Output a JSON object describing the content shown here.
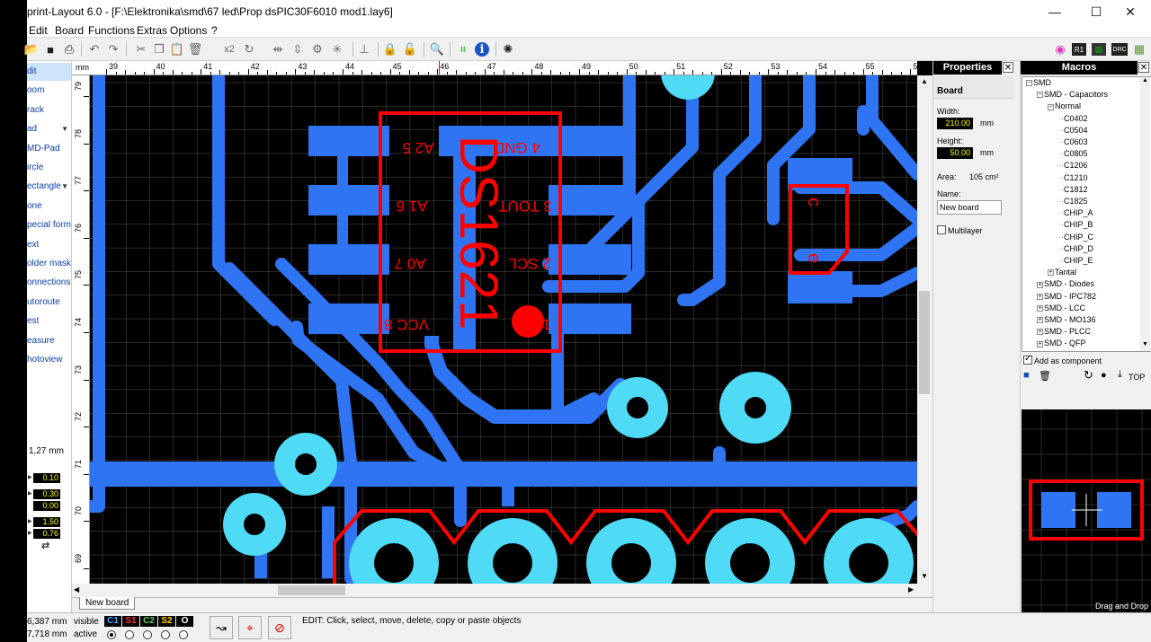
{
  "window": {
    "title": "print-Layout 6.0 - [F:\\Elektronika\\smd\\67 led\\Prop dsPIC30F6010 mod1.lay6]",
    "minimize": "—",
    "maximize": "☐",
    "close": "✕"
  },
  "menu": [
    "Edit",
    "Board",
    "Functions",
    "Extras",
    "Options",
    "?"
  ],
  "toolbar": {
    "zoom_icon": "🔍",
    "x2": "x2",
    "info": "i"
  },
  "tools": [
    {
      "label": "dit",
      "selected": true
    },
    {
      "label": "oom"
    },
    {
      "label": "rack"
    },
    {
      "label": "ad",
      "arrow": true
    },
    {
      "label": "MD-Pad"
    },
    {
      "label": "ircle"
    },
    {
      "label": "ectangle",
      "arrow": true
    },
    {
      "label": "one"
    },
    {
      "label": "pecial form"
    },
    {
      "label": "ext"
    },
    {
      "label": "older mask"
    },
    {
      "label": "onnections"
    },
    {
      "label": "utoroute"
    },
    {
      "label": "est"
    },
    {
      "label": "easure"
    },
    {
      "label": "hotoview"
    }
  ],
  "grid": "1,27 mm",
  "numvals": [
    "0.10",
    "0.30",
    "0.00",
    "1.50",
    "0.76"
  ],
  "hruler_label": "mm",
  "hruler_ticks": [
    "39",
    "40",
    "41",
    "42",
    "43",
    "44",
    "45",
    "46",
    "47",
    "48",
    "49",
    "50",
    "51",
    "52",
    "53",
    "54",
    "55",
    "56"
  ],
  "vruler_ticks": [
    "79",
    "78",
    "77",
    "76",
    "75",
    "74",
    "73",
    "72",
    "71",
    "70",
    "69"
  ],
  "silk": {
    "ic_name": "DS1621",
    "pin_labels": [
      "A2 5",
      "A1 6",
      "A0 7",
      "VCC 8",
      "4 GND",
      "3 TOUT",
      "2 SCL",
      "1"
    ],
    "cap_labels": [
      "c",
      "e"
    ]
  },
  "tab": "New board",
  "status": {
    "coord_x": "6,387 mm",
    "coord_y": "7,718 mm",
    "visible": "visible",
    "active": "active",
    "layers": [
      {
        "name": "C1",
        "color": "#4aa3ff"
      },
      {
        "name": "S1",
        "color": "#ff3030"
      },
      {
        "name": "C2",
        "color": "#5fd35f"
      },
      {
        "name": "S2",
        "color": "#ffd700"
      },
      {
        "name": "O",
        "color": "#ffffff"
      }
    ],
    "message": "EDIT:  Click, select, move, delete, copy or paste objects"
  },
  "properties": {
    "header": "Properties",
    "section": "Board",
    "width_label": "Width:",
    "width_value": "210.00",
    "height_label": "Height:",
    "height_value": "50.00",
    "unit": "mm",
    "area_label": "Area:",
    "area_value": "105 cm²",
    "name_label": "Name:",
    "name_value": "New board",
    "multilayer": "Multilayer"
  },
  "macros": {
    "header": "Macros",
    "tree": [
      {
        "label": "SMD",
        "level": 0,
        "box": "−"
      },
      {
        "label": "SMD - Capacitors",
        "level": 1,
        "box": "−"
      },
      {
        "label": "Normal",
        "level": 2,
        "box": "−"
      },
      {
        "label": "C0402",
        "level": 3
      },
      {
        "label": "C0504",
        "level": 3
      },
      {
        "label": "C0603",
        "level": 3
      },
      {
        "label": "C0805",
        "level": 3
      },
      {
        "label": "C1206",
        "level": 3
      },
      {
        "label": "C1210",
        "level": 3
      },
      {
        "label": "C1812",
        "level": 3
      },
      {
        "label": "C1825",
        "level": 3
      },
      {
        "label": "CHIP_A",
        "level": 3
      },
      {
        "label": "CHIP_B",
        "level": 3
      },
      {
        "label": "CHIP_C",
        "level": 3
      },
      {
        "label": "CHIP_D",
        "level": 3
      },
      {
        "label": "CHIP_E",
        "level": 3
      },
      {
        "label": "Tantal",
        "level": 2,
        "box": "+"
      },
      {
        "label": "SMD - Diodes",
        "level": 1,
        "box": "+"
      },
      {
        "label": "SMD - IPC782",
        "level": 1,
        "box": "+"
      },
      {
        "label": "SMD - LCC",
        "level": 1,
        "box": "+"
      },
      {
        "label": "SMD - MO136",
        "level": 1,
        "box": "+"
      },
      {
        "label": "SMD - PLCC",
        "level": 1,
        "box": "+"
      },
      {
        "label": "SMD - QFP",
        "level": 1,
        "box": "+"
      }
    ],
    "add_as_component": "Add as component",
    "top": "TOP",
    "drag_drop": "Drag and Drop"
  },
  "colors": {
    "copper_top": "#2f74f2",
    "silk": "#ff0000",
    "pad_ring": "#4fdaf5",
    "grid": "#555555"
  }
}
